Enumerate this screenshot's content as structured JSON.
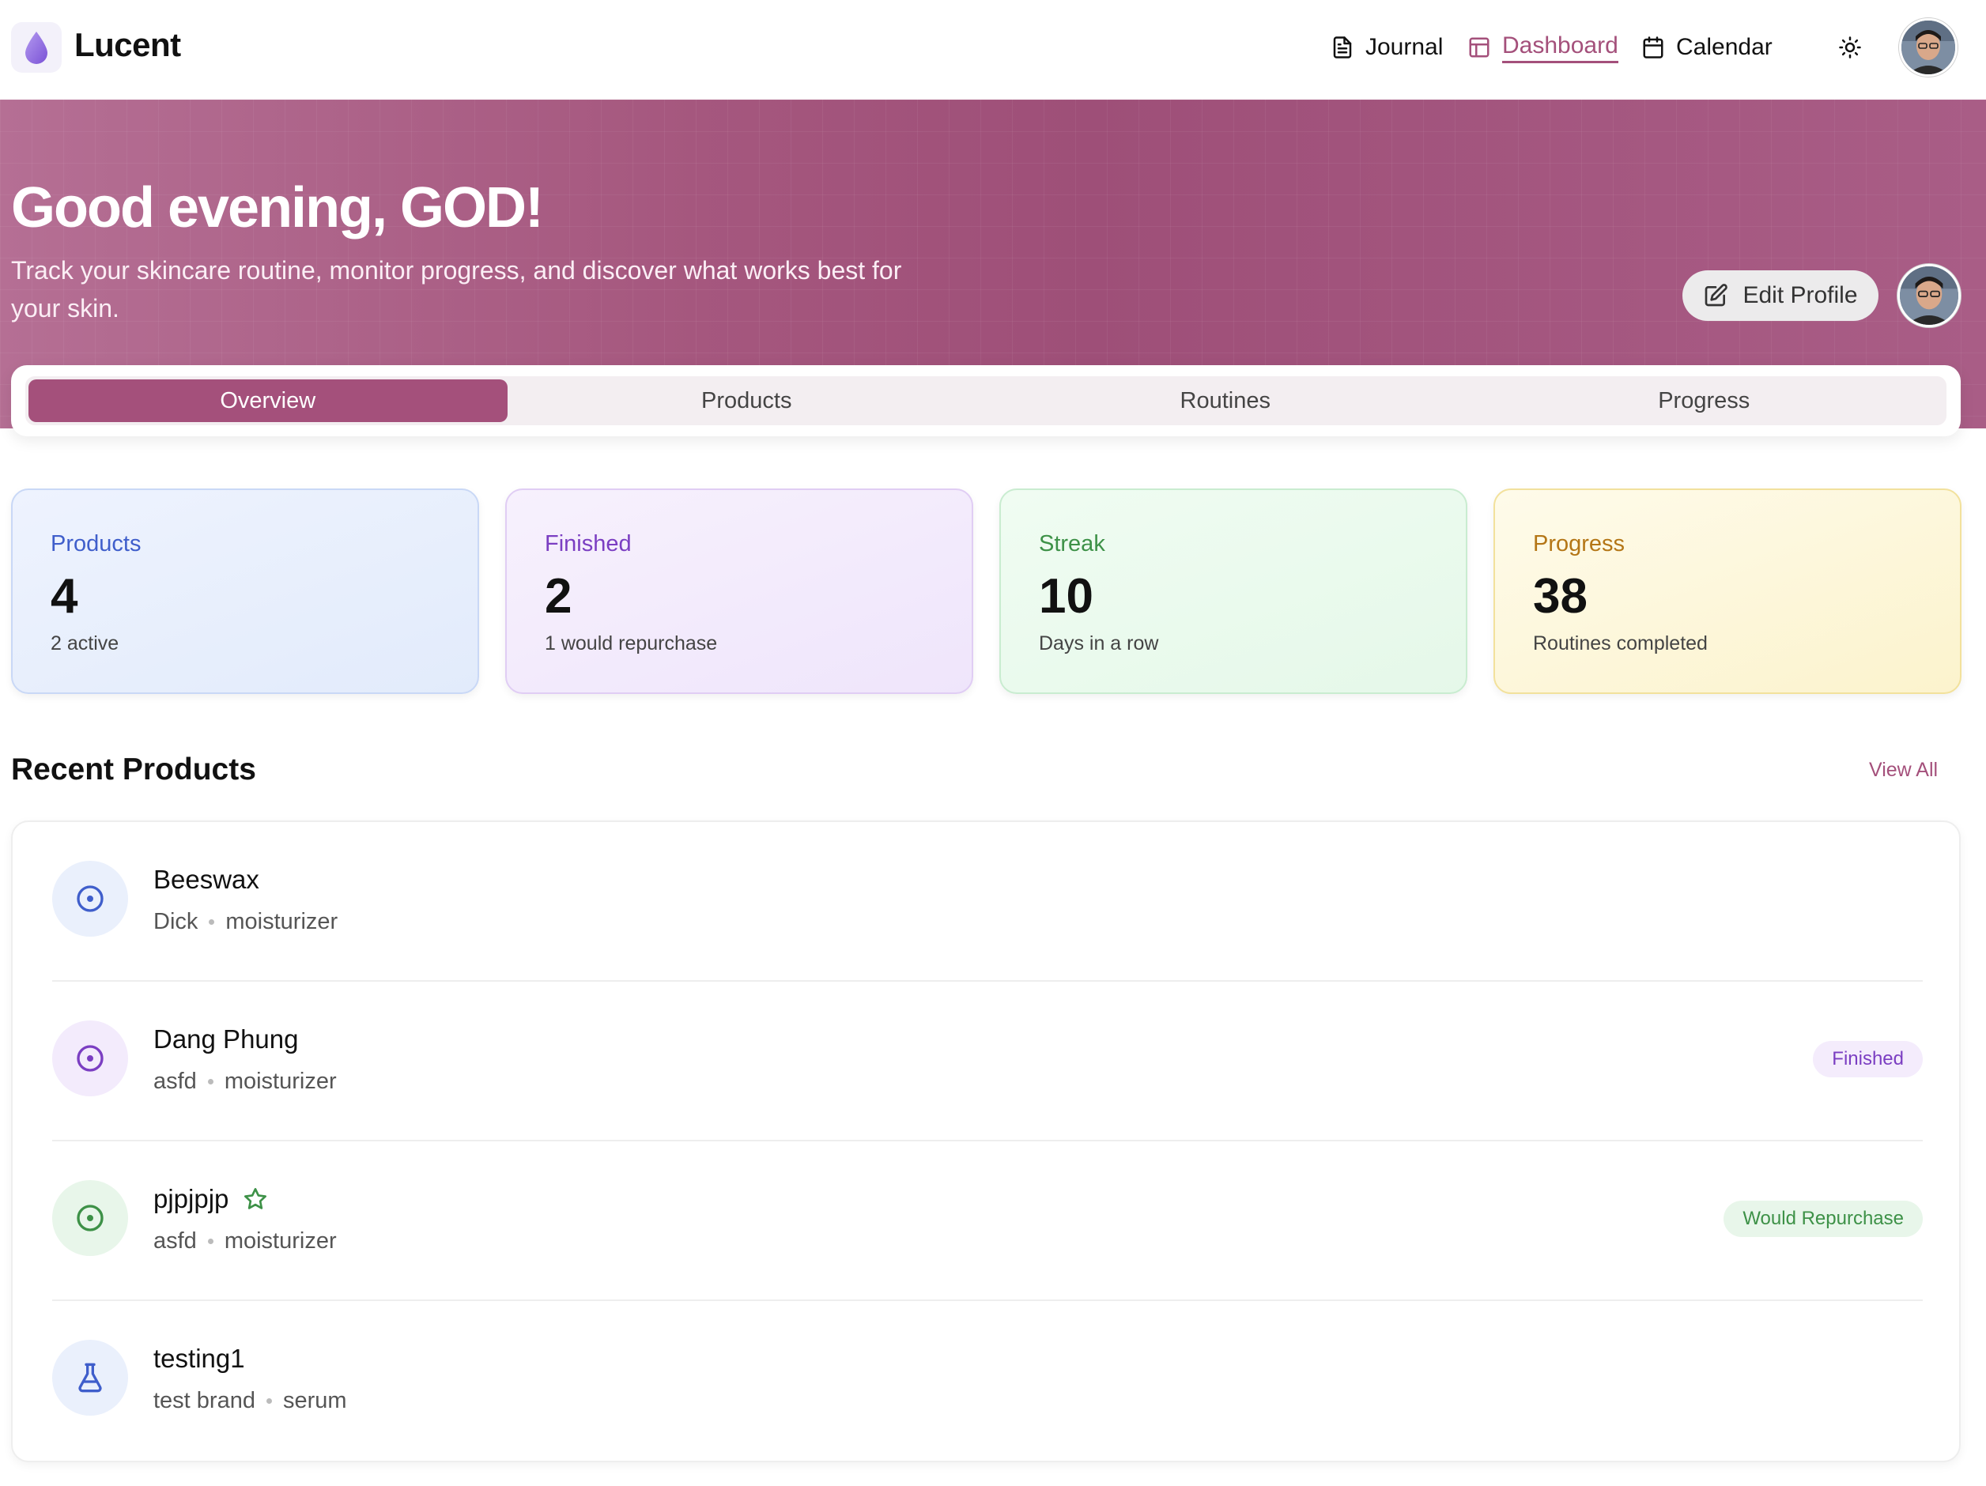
{
  "app": {
    "name": "Lucent"
  },
  "nav": {
    "journal": "Journal",
    "dashboard": "Dashboard",
    "calendar": "Calendar",
    "active": "Dashboard"
  },
  "hero": {
    "greeting": "Good evening, GOD!",
    "subtitle": "Track your skincare routine, monitor progress, and discover what works best for your skin.",
    "edit_profile": "Edit Profile"
  },
  "tabs": [
    {
      "label": "Overview",
      "active": true
    },
    {
      "label": "Products",
      "active": false
    },
    {
      "label": "Routines",
      "active": false
    },
    {
      "label": "Progress",
      "active": false
    }
  ],
  "stats": [
    {
      "label": "Products",
      "value": "4",
      "sub": "2 active"
    },
    {
      "label": "Finished",
      "value": "2",
      "sub": "1 would repurchase"
    },
    {
      "label": "Streak",
      "value": "10",
      "sub": "Days in a row"
    },
    {
      "label": "Progress",
      "value": "38",
      "sub": "Routines completed"
    }
  ],
  "recent": {
    "title": "Recent Products",
    "view_all": "View All",
    "items": [
      {
        "name": "Beeswax",
        "brand": "Dick",
        "category": "moisturizer",
        "icon": "target-icon",
        "badge": ""
      },
      {
        "name": "Dang Phung",
        "brand": "asfd",
        "category": "moisturizer",
        "icon": "target-icon",
        "badge": "Finished"
      },
      {
        "name": "pjpjpjp",
        "brand": "asfd",
        "category": "moisturizer",
        "icon": "target-icon",
        "badge": "Would Repurchase",
        "starred": true
      },
      {
        "name": "testing1",
        "brand": "test brand",
        "category": "serum",
        "icon": "flask-icon",
        "badge": ""
      }
    ]
  },
  "colors": {
    "accent": "#a4507b",
    "products": "#3f5ecb",
    "finished": "#7b3ec2",
    "streak": "#3d9147",
    "progress": "#b47616"
  }
}
